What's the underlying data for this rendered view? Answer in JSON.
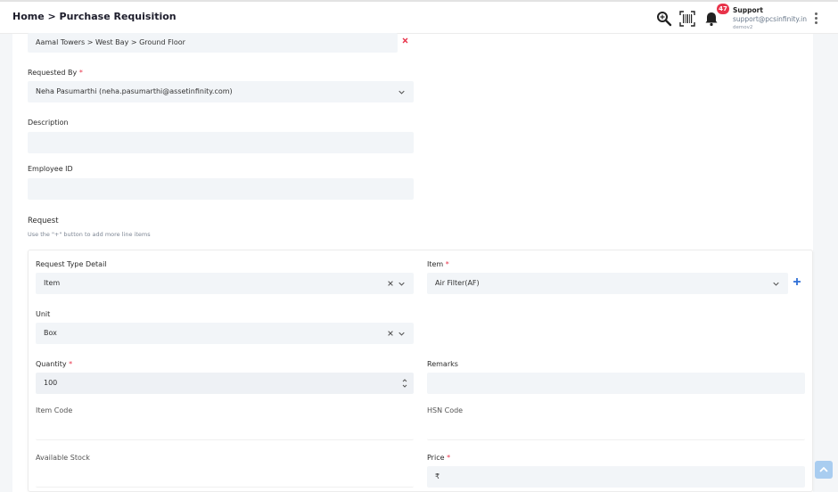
{
  "header": {
    "breadcrumb": "Home > Purchase Requisition",
    "notification_count": "47",
    "user_name": "Support",
    "user_email": "support@pcsinfinity.in",
    "user_tenant": "demov2",
    "icons": [
      "search-icon",
      "barcode-scan-icon",
      "bell-icon",
      "more-vertical-icon"
    ]
  },
  "form": {
    "location_value": "Aamal Towers > West Bay > Ground Floor",
    "requested_by_label": "Requested By",
    "requested_by_value": "Neha Pasumarthi (neha.pasumarthi@assetinfinity.com)",
    "description_label": "Description",
    "description_value": "",
    "employee_id_label": "Employee ID",
    "employee_id_value": "",
    "request_label": "Request",
    "request_hint": "Use the \"+\" button to add more line items"
  },
  "line_item": {
    "request_type_label": "Request Type Detail",
    "request_type_value": "Item",
    "item_label": "Item",
    "item_value": "Air Filter(AF)",
    "unit_label": "Unit",
    "unit_value": "Box",
    "quantity_label": "Quantity",
    "quantity_value": "100",
    "remarks_label": "Remarks",
    "remarks_value": "",
    "item_code_label": "Item Code",
    "item_code_value": "",
    "hsn_code_label": "HSN Code",
    "hsn_code_value": "",
    "available_stock_label": "Available Stock",
    "available_stock_value": "",
    "price_label": "Price",
    "price_value": "₹"
  },
  "required_marker": "*",
  "colors": {
    "required": "#e8334a",
    "field_bg": "#f2f5f8",
    "accent": "#2f6fd6"
  }
}
